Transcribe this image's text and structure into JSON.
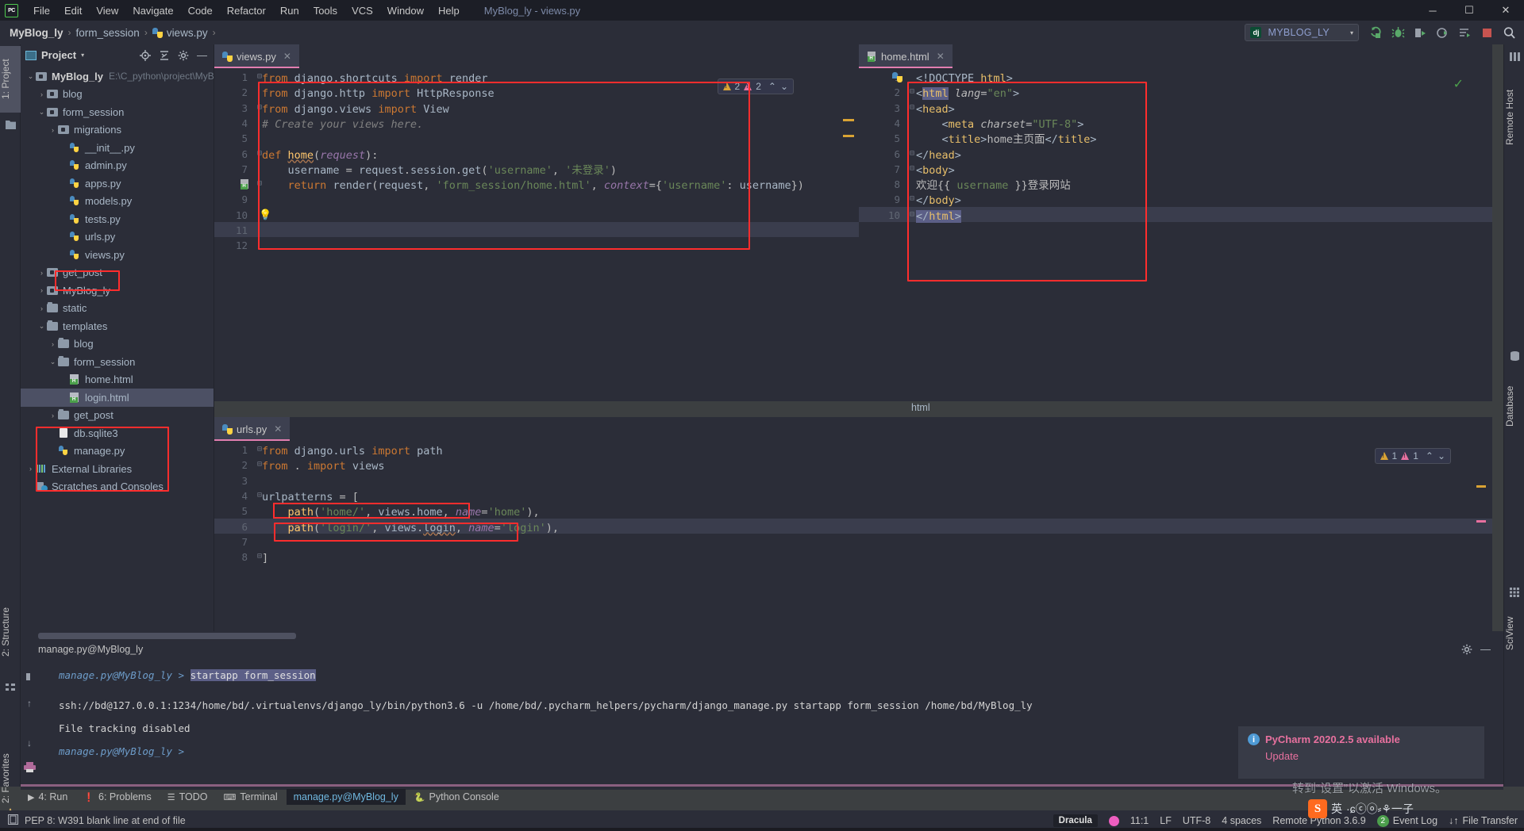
{
  "titlebar": {
    "logo": "pc-logo",
    "menus": [
      "File",
      "Edit",
      "View",
      "Navigate",
      "Code",
      "Refactor",
      "Run",
      "Tools",
      "VCS",
      "Window",
      "Help"
    ],
    "window_title": "MyBlog_ly - views.py",
    "minimize": "─",
    "maximize": "☐",
    "close": "✕"
  },
  "breadcrumb": {
    "project": "MyBlog_ly",
    "folder": "form_session",
    "file": "views.py",
    "sep": "›"
  },
  "toolbar": {
    "run_config": "MYBLOG_LY",
    "config_caret": "▾",
    "icons": [
      "rerun-icon",
      "debug-icon",
      "coverage-icon",
      "profile-icon",
      "run-with-console-icon",
      "stop-icon",
      "search-everywhere-icon"
    ]
  },
  "left_strip": {
    "project_tab": "1: Project",
    "structure_tab": "2: Structure",
    "favorites_tab": "2: Favorites"
  },
  "right_strip": {
    "remote_host": "Remote Host",
    "database": "Database",
    "sciview": "SciView"
  },
  "project_panel": {
    "title": "Project",
    "caret": "▾",
    "icons": [
      "locate-icon",
      "collapse-all-icon",
      "gear-icon",
      "hide-icon"
    ],
    "tree": [
      {
        "label": "MyBlog_ly",
        "path": "E:\\C_python\\project\\MyB",
        "indent": 0,
        "arrow": "⌄",
        "icon": "mod",
        "bold": true
      },
      {
        "label": "blog",
        "indent": 1,
        "arrow": "›",
        "icon": "mod"
      },
      {
        "label": "form_session",
        "indent": 1,
        "arrow": "⌄",
        "icon": "mod"
      },
      {
        "label": "migrations",
        "indent": 2,
        "arrow": "›",
        "icon": "mod"
      },
      {
        "label": "__init__.py",
        "indent": 3,
        "arrow": "",
        "icon": "py"
      },
      {
        "label": "admin.py",
        "indent": 3,
        "arrow": "",
        "icon": "py"
      },
      {
        "label": "apps.py",
        "indent": 3,
        "arrow": "",
        "icon": "py"
      },
      {
        "label": "models.py",
        "indent": 3,
        "arrow": "",
        "icon": "py"
      },
      {
        "label": "tests.py",
        "indent": 3,
        "arrow": "",
        "icon": "py"
      },
      {
        "label": "urls.py",
        "indent": 3,
        "arrow": "",
        "icon": "py",
        "highlight": true
      },
      {
        "label": "views.py",
        "indent": 3,
        "arrow": "",
        "icon": "py"
      },
      {
        "label": "get_post",
        "indent": 1,
        "arrow": "›",
        "icon": "mod"
      },
      {
        "label": "MyBlog_ly",
        "indent": 1,
        "arrow": "›",
        "icon": "mod"
      },
      {
        "label": "static",
        "indent": 1,
        "arrow": "›",
        "icon": "folder"
      },
      {
        "label": "templates",
        "indent": 1,
        "arrow": "⌄",
        "icon": "folder"
      },
      {
        "label": "blog",
        "indent": 2,
        "arrow": "›",
        "icon": "folder"
      },
      {
        "label": "form_session",
        "indent": 2,
        "arrow": "⌄",
        "icon": "folder"
      },
      {
        "label": "home.html",
        "indent": 3,
        "arrow": "",
        "icon": "html"
      },
      {
        "label": "login.html",
        "indent": 3,
        "arrow": "",
        "icon": "html",
        "selected": true
      },
      {
        "label": "get_post",
        "indent": 2,
        "arrow": "›",
        "icon": "folder"
      },
      {
        "label": "db.sqlite3",
        "indent": 2,
        "arrow": "",
        "icon": "file"
      },
      {
        "label": "manage.py",
        "indent": 2,
        "arrow": "",
        "icon": "py"
      },
      {
        "label": "External Libraries",
        "indent": 0,
        "arrow": "›",
        "icon": "lib"
      },
      {
        "label": "Scratches and Consoles",
        "indent": 0,
        "arrow": "",
        "icon": "scr"
      }
    ]
  },
  "editor_views": {
    "tab": "views.py",
    "tab_close": "✕",
    "inspections": {
      "warn_count": "2",
      "typo_count": "2",
      "up": "⌃",
      "down": "⌄"
    },
    "lines": [
      {
        "n": "1",
        "html": "<span class='kw'>from</span> <span class='id'>django.shortcuts</span> <span class='kw'>import</span> <span class='id'>render</span>",
        "fold": "⊟"
      },
      {
        "n": "2",
        "html": "<span class='kw'>from</span> <span class='id'>django.http</span> <span class='kw'>import</span> <span class='id'>HttpResponse</span>"
      },
      {
        "n": "3",
        "html": "<span class='kw'>from</span> <span class='id'>django.views</span> <span class='kw'>import</span> <span class='id'>View</span>",
        "fold": "⊟"
      },
      {
        "n": "4",
        "html": "<span class='cmt'># Create your views here.</span>"
      },
      {
        "n": "5",
        "html": ""
      },
      {
        "n": "6",
        "html": "<span class='kw'>def</span> <span class='fn err-underline'>home</span>(<span class='par'>request</span>):",
        "fold": "⊟"
      },
      {
        "n": "7",
        "html": "    <span class='id'>username</span> = <span class='id'>request</span>.<span class='id'>session</span>.<span class='id'>get</span>(<span class='str'>'username'</span>, <span class='str'>'未登录'</span>)"
      },
      {
        "n": "8",
        "html": "    <span class='kw'>return</span> <span class='id'>render</span>(<span class='id'>request</span>, <span class='str'>'form_session/home.html'</span>, <span class='par'>context</span>={<span class='str'>'username'</span>: <span class='id'>username</span>})",
        "gutter_icon": "html-file-icon",
        "fold": "⊟"
      },
      {
        "n": "9",
        "html": ""
      },
      {
        "n": "10",
        "html": "",
        "bulb": true
      },
      {
        "n": "11",
        "html": "",
        "current": true
      },
      {
        "n": "12",
        "html": ""
      }
    ]
  },
  "editor_home": {
    "tab": "home.html",
    "tab_close": "✕",
    "ok_check": "✓",
    "breadcrumb": "html",
    "lines": [
      {
        "n": "1",
        "html": "<span class='txt'>&lt;!DOCTYPE <span class='tag'>html</span>&gt;</span>",
        "gutter_icon": "python-icon"
      },
      {
        "n": "2",
        "html": "<span class='txt'>&lt;</span><span class='tag sel-hl'>html</span> <span class='attr'>lang</span>=<span class='str'>\"en\"</span><span class='txt'>&gt;</span>",
        "fold": "⊟"
      },
      {
        "n": "3",
        "html": "<span class='txt'>&lt;</span><span class='tag'>head</span><span class='txt'>&gt;</span>",
        "fold": "⊟"
      },
      {
        "n": "4",
        "html": "    <span class='txt'>&lt;</span><span class='tag'>meta</span> <span class='attr'>charset</span>=<span class='str'>\"UTF-8\"</span><span class='txt'>&gt;</span>"
      },
      {
        "n": "5",
        "html": "    <span class='txt'>&lt;</span><span class='tag'>title</span><span class='txt'>&gt;</span>home主页面<span class='txt'>&lt;/</span><span class='tag'>title</span><span class='txt'>&gt;</span>"
      },
      {
        "n": "6",
        "html": "<span class='txt'>&lt;/</span><span class='tag'>head</span><span class='txt'>&gt;</span>",
        "fold": "⊟"
      },
      {
        "n": "7",
        "html": "<span class='txt'>&lt;</span><span class='tag'>body</span><span class='txt'>&gt;</span>",
        "fold": "⊟"
      },
      {
        "n": "8",
        "html": "欢迎{{ <span class='str'>username</span> }}登录网站"
      },
      {
        "n": "9",
        "html": "<span class='txt'>&lt;/</span><span class='tag'>body</span><span class='txt'>&gt;</span>",
        "fold": "⊟"
      },
      {
        "n": "10",
        "html": "<span class='txt sel-hl'>&lt;/</span><span class='tag sel-hl'>html</span><span class='txt sel-hl'>&gt;</span>",
        "current": true,
        "fold": "⊟"
      }
    ]
  },
  "editor_urls": {
    "tab": "urls.py",
    "tab_close": "✕",
    "inspections": {
      "warn_count": "1",
      "typo_count": "1",
      "up": "⌃",
      "down": "⌄"
    },
    "lines": [
      {
        "n": "1",
        "html": "<span class='kw'>from</span> <span class='id'>django.urls</span> <span class='kw'>import</span> <span class='id'>path</span>",
        "fold": "⊟"
      },
      {
        "n": "2",
        "html": "<span class='kw'>from</span> . <span class='kw'>import</span> <span class='id'>views</span>",
        "fold": "⊟"
      },
      {
        "n": "3",
        "html": ""
      },
      {
        "n": "4",
        "html": "<span class='id'>urlpatterns</span> = [",
        "fold": "⊟"
      },
      {
        "n": "5",
        "html": "    <span class='fn'>path</span>(<span class='str'>'home/'</span>, <span class='id'>views</span>.<span class='id'>home</span>, <span class='par'>name</span>=<span class='str'>'home'</span>),",
        "highlight": true
      },
      {
        "n": "6",
        "html": "    <span class='fn'>path</span>(<span class='str'>'login/'</span>, <span class='id'>views</span>.<span class='id err-underline'>login</span>, <span class='par'>name</span>=<span class='str'>'login'</span>),",
        "current": true
      },
      {
        "n": "7",
        "html": ""
      },
      {
        "n": "8",
        "html": "]",
        "fold": "⊟"
      }
    ]
  },
  "console": {
    "title": "manage.py@MyBlog_ly",
    "gear": "gear-icon",
    "hide": "─",
    "lines": [
      {
        "prompt": "manage.py@MyBlog_ly > ",
        "cmd": "startapp form_session",
        "selected": true
      },
      {
        "out": "ssh://bd@127.0.0.1:1234/home/bd/.virtualenvs/django_ly/bin/python3.6 -u /home/bd/.pycharm_helpers/pycharm/django_manage.py startapp form_session /home/bd/MyBlog_ly"
      },
      {
        "out": "File tracking disabled"
      },
      {
        "prompt": "manage.py@MyBlog_ly > ",
        "cmd": ""
      }
    ],
    "side_icons": [
      "up-arrow-icon",
      "down-arrow-icon",
      "soft-wrap-icon",
      "scroll-to-end-icon",
      "print-icon"
    ]
  },
  "bottom_tabs": [
    {
      "label": "4: Run",
      "icon": "run-icon",
      "selected": false
    },
    {
      "label": "6: Problems",
      "icon": "problems-icon",
      "selected": false
    },
    {
      "label": "TODO",
      "icon": "todo-icon",
      "selected": false
    },
    {
      "label": "Terminal",
      "icon": "terminal-icon",
      "selected": false
    },
    {
      "label": "manage.py@MyBlog_ly",
      "icon": "",
      "selected": true
    },
    {
      "label": "Python Console",
      "icon": "python-icon",
      "selected": false
    }
  ],
  "statusbar": {
    "message": "PEP 8: W391 blank line at end of file",
    "theme": "Dracula",
    "caret": "11:1",
    "line_sep": "LF",
    "encoding": "UTF-8",
    "indent": "4 spaces",
    "interpreter": "Remote Python 3.6.9",
    "event_log": "Event Log",
    "event_count": "2",
    "file_transfer": "File Transfer",
    "transfer_icon": "↓↑"
  },
  "notification": {
    "icon": "info-icon",
    "title": "PyCharm 2020.2.5 available",
    "action": "Update"
  },
  "watermark": {
    "line1": "激活 Windows",
    "line2": "转到“设置”以激活 Windows。"
  },
  "ime": {
    "app": "S",
    "mode": "英",
    "glyphs": "·ɕⓒⓞ⸗⚘一子"
  },
  "colors": {
    "accent_pink": "#e8719f",
    "bg_dark": "#1c1e26",
    "bg_panel": "#2b2d38",
    "bg_editor": "#2b2d38",
    "annotation_red": "#ff2d2d",
    "string_green": "#6a8759",
    "keyword_orange": "#cc7832"
  }
}
